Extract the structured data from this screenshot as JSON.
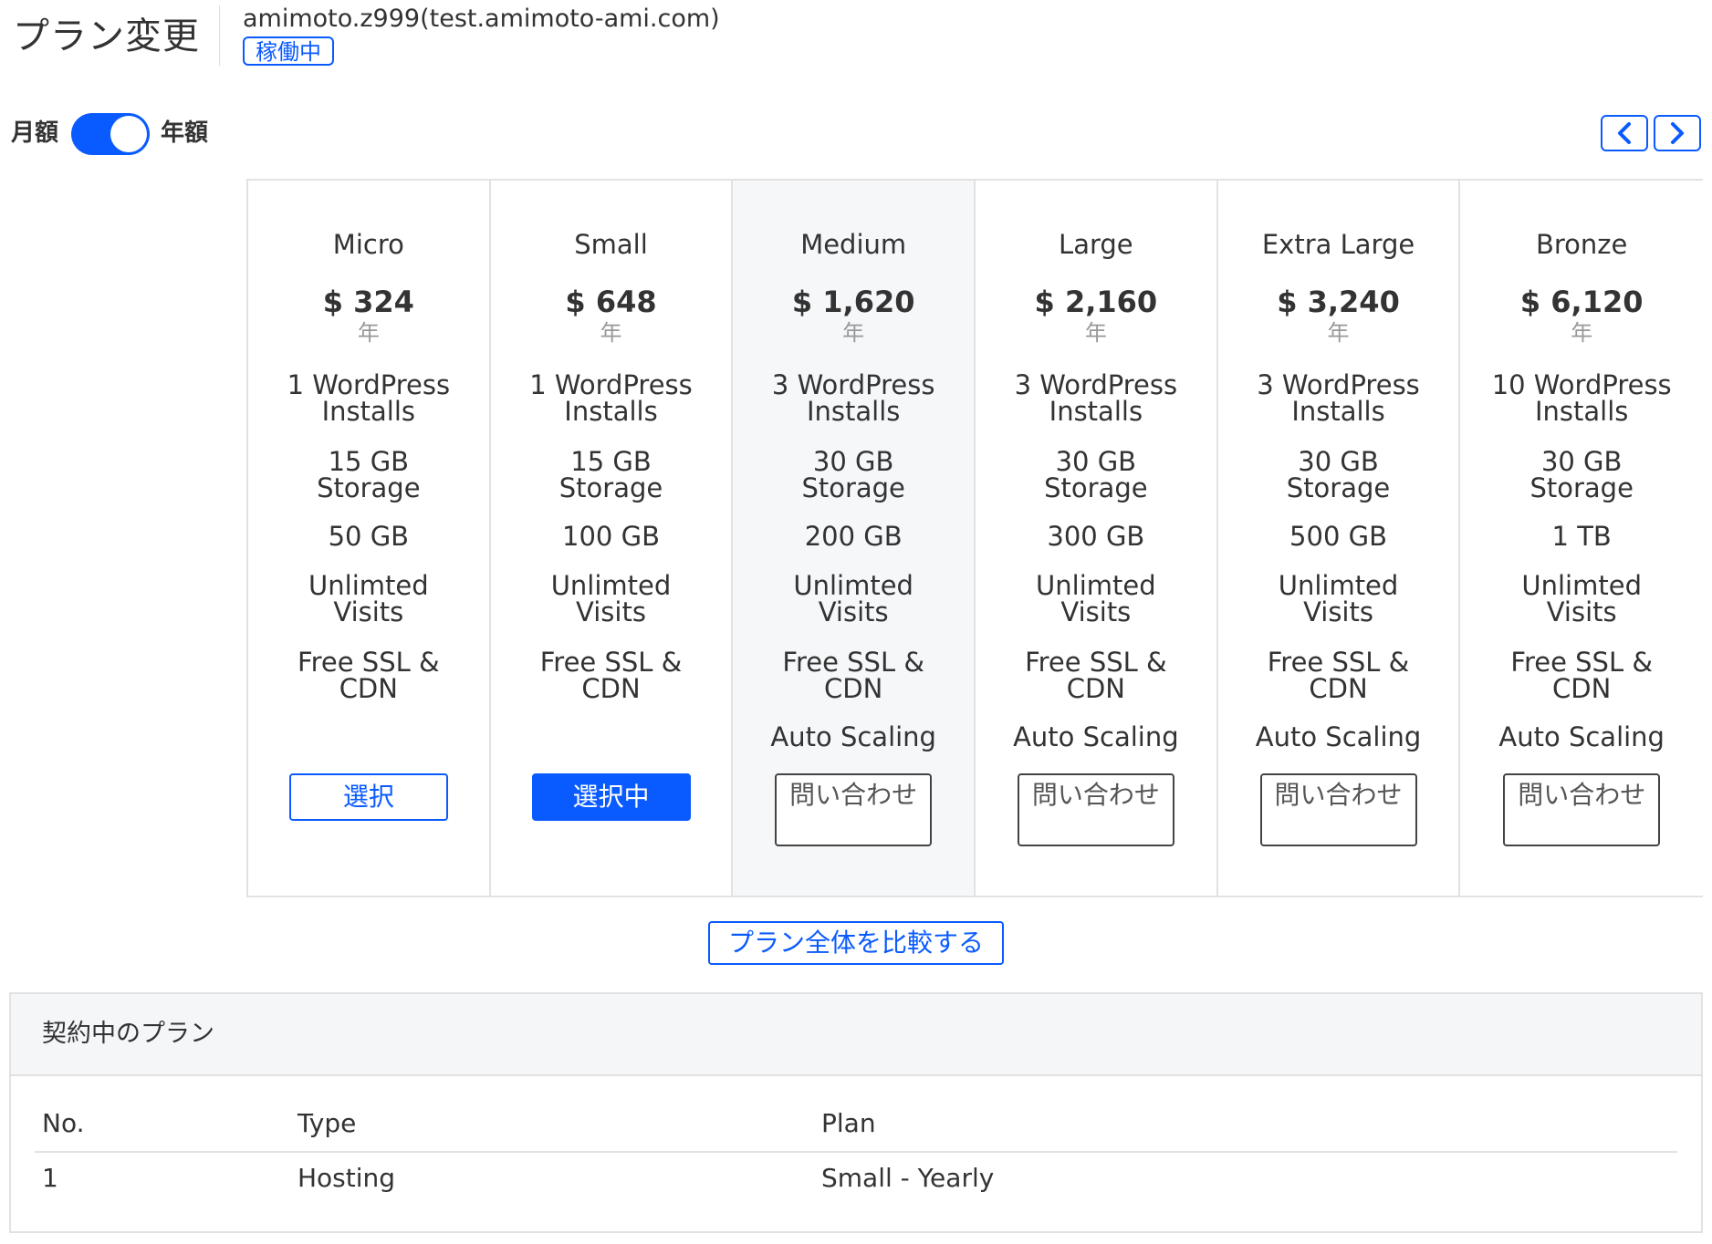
{
  "header": {
    "title": "プラン変更",
    "site_name": "amimoto.z999(test.amimoto-ami.com)",
    "status_badge": "稼働中"
  },
  "billing_toggle": {
    "monthly_label": "月額",
    "yearly_label": "年額",
    "selected": "yearly"
  },
  "plans": [
    {
      "name": "Micro",
      "price": "$ 324",
      "period": "年",
      "installs": [
        "1 WordPress",
        "Installs"
      ],
      "storage": [
        "15 GB",
        "Storage"
      ],
      "transfer": "50 GB",
      "visits": [
        "Unlimted",
        "Visits"
      ],
      "ssl": [
        "Free SSL &",
        "CDN"
      ],
      "scaling": "",
      "button": "選択",
      "button_state": "select"
    },
    {
      "name": "Small",
      "price": "$ 648",
      "period": "年",
      "installs": [
        "1 WordPress",
        "Installs"
      ],
      "storage": [
        "15 GB",
        "Storage"
      ],
      "transfer": "100 GB",
      "visits": [
        "Unlimted",
        "Visits"
      ],
      "ssl": [
        "Free SSL &",
        "CDN"
      ],
      "scaling": "",
      "button": "選択中",
      "button_state": "selected"
    },
    {
      "name": "Medium",
      "price": "$ 1,620",
      "period": "年",
      "installs": [
        "3 WordPress",
        "Installs"
      ],
      "storage": [
        "30 GB",
        "Storage"
      ],
      "transfer": "200 GB",
      "visits": [
        "Unlimted",
        "Visits"
      ],
      "ssl": [
        "Free SSL &",
        "CDN"
      ],
      "scaling": "Auto Scaling",
      "button": "問い合わせ",
      "button_state": "contact",
      "highlight": true
    },
    {
      "name": "Large",
      "price": "$ 2,160",
      "period": "年",
      "installs": [
        "3 WordPress",
        "Installs"
      ],
      "storage": [
        "30 GB",
        "Storage"
      ],
      "transfer": "300 GB",
      "visits": [
        "Unlimted",
        "Visits"
      ],
      "ssl": [
        "Free SSL &",
        "CDN"
      ],
      "scaling": "Auto Scaling",
      "button": "問い合わせ",
      "button_state": "contact"
    },
    {
      "name": "Extra Large",
      "price": "$ 3,240",
      "period": "年",
      "installs": [
        "3 WordPress",
        "Installs"
      ],
      "storage": [
        "30 GB",
        "Storage"
      ],
      "transfer": "500 GB",
      "visits": [
        "Unlimted",
        "Visits"
      ],
      "ssl": [
        "Free SSL &",
        "CDN"
      ],
      "scaling": "Auto Scaling",
      "button": "問い合わせ",
      "button_state": "contact"
    },
    {
      "name": "Bronze",
      "price": "$ 6,120",
      "period": "年",
      "installs": [
        "10 WordPress",
        "Installs"
      ],
      "storage": [
        "30 GB",
        "Storage"
      ],
      "transfer": "1 TB",
      "visits": [
        "Unlimted",
        "Visits"
      ],
      "ssl": [
        "Free SSL &",
        "CDN"
      ],
      "scaling": "Auto Scaling",
      "button": "問い合わせ",
      "button_state": "contact"
    }
  ],
  "compare_button": "プラン全体を比較する",
  "current_plan": {
    "title": "契約中のプラン",
    "columns": [
      "No.",
      "Type",
      "Plan"
    ],
    "rows": [
      [
        "1",
        "Hosting",
        "Small - Yearly"
      ]
    ]
  },
  "icons": {
    "prev": "chevron-left-icon",
    "next": "chevron-right-icon"
  },
  "colors": {
    "accent": "#0a5bff",
    "highlight_column": "#f5f7f9",
    "border": "#e2e2e2"
  }
}
